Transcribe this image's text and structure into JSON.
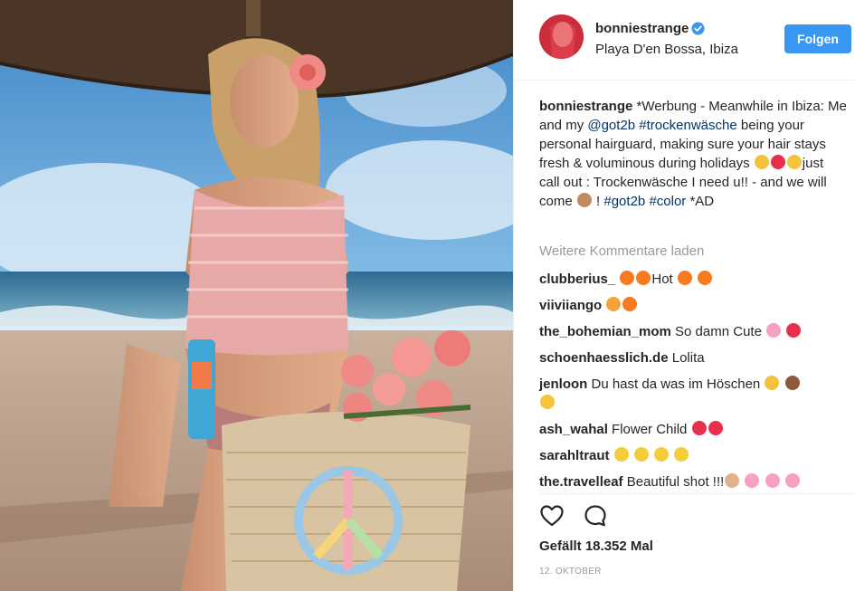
{
  "post": {
    "photo_alt": "Woman in pink crochet top at beach under umbrella holding straw bag with flowers",
    "username": "bonniestrange",
    "location": "Playa D'en Bossa, Ibiza",
    "follow_label": "Folgen"
  },
  "caption": {
    "username": "bonniestrange",
    "text_1": " *Werbung - Meanwhile in Ibiza: Me and my ",
    "mention": "@got2b",
    "text_2": " ",
    "tag_1": "#trockenwäsche",
    "text_3": " being your personal hairguard, making sure your hair stays fresh & voluminous during holidays ",
    "text_4": "just call out : Trockenwäsche I need u!! - and we will come ",
    "text_5": " ! ",
    "tag_2": "#got2b",
    "text_6": " ",
    "tag_3": "#color",
    "text_7": " *AD"
  },
  "load_more_label": "Weitere Kommentare laden",
  "comments": [
    {
      "user": "clubberius_",
      "text": "Hot"
    },
    {
      "user": "viiviiango",
      "text": ""
    },
    {
      "user": "the_bohemian_mom",
      "text": "So damn Cute"
    },
    {
      "user": "schoenhaesslich.de",
      "text": "Lolita"
    },
    {
      "user": "jenloon",
      "text": "Du hast da was im Höschen"
    },
    {
      "user": "ash_wahal",
      "text": "Flower Child"
    },
    {
      "user": "sarahltraut",
      "text": ""
    },
    {
      "user": "the.travelleaf",
      "text": "Beautiful shot !!!"
    }
  ],
  "icons": {
    "like": "heart-outline-icon",
    "comment": "speech-bubble-icon",
    "verified": "verified-badge-icon"
  },
  "likes_label": "Gefällt 18.352 Mal",
  "date_label": "12. OKTOBER",
  "colors": {
    "accent": "#3897f0",
    "hashtag": "#003569",
    "muted": "#999999"
  }
}
